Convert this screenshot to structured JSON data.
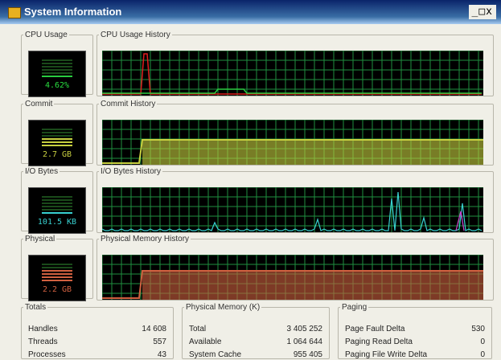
{
  "window": {
    "title": "System Information",
    "controls": {
      "minimize": "_",
      "maximize": "□",
      "close": "x"
    }
  },
  "colors": {
    "grid": "#1f8f40",
    "cpu": "#e01e1e",
    "cpu_kernel": "#2acc40",
    "commit": "#c8d040",
    "io": "#38d0d0",
    "io_alt": "#d040d0",
    "physical": "#d06040",
    "meter_text": "#2adf40"
  },
  "cpu": {
    "label": "CPU Usage",
    "history_label": "CPU Usage History",
    "value": "4.62%",
    "level": 0.05
  },
  "commit": {
    "label": "Commit",
    "history_label": "Commit History",
    "value": "2.7 GB",
    "level": 0.55
  },
  "io": {
    "label": "I/O Bytes",
    "history_label": "I/O Bytes History",
    "value": "101.5 KB",
    "level": 0.05
  },
  "physical": {
    "label": "Physical",
    "history_label": "Physical Memory History",
    "value": "2.2 GB",
    "level": 0.65
  },
  "totals": {
    "label": "Totals",
    "rows": [
      {
        "name": "Handles",
        "value": "14 608"
      },
      {
        "name": "Threads",
        "value": "557"
      },
      {
        "name": "Processes",
        "value": "43"
      }
    ]
  },
  "physical_memory": {
    "label": "Physical Memory (K)",
    "rows": [
      {
        "name": "Total",
        "value": "3 405 252"
      },
      {
        "name": "Available",
        "value": "1 064 644"
      },
      {
        "name": "System Cache",
        "value": "955 405"
      }
    ]
  },
  "paging": {
    "label": "Paging",
    "rows": [
      {
        "name": "Page Fault Delta",
        "value": "530"
      },
      {
        "name": "Paging Read Delta",
        "value": "0"
      },
      {
        "name": "Paging File Write Delta",
        "value": "0"
      }
    ]
  }
}
